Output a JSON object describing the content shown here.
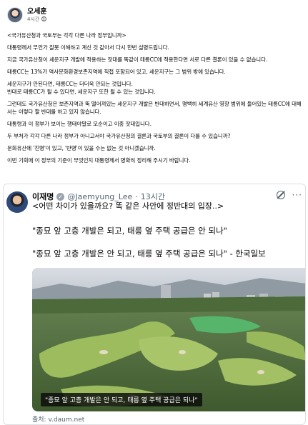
{
  "post": {
    "author": "오세훈",
    "time": "4시간",
    "paragraphs": [
      "<국가유산청과 국토부는 각각 다른 나라 정부입니까>",
      "대통령께서 무언가 잘못 이해하고 계신 것 같아서 다시 한번 설명드립니다.",
      "지금 국가유산청이 세운지구 개발에 적용하는 잣대를 똑같이 태릉CC에 적용한다면 서로 다른 결론이 있을 수 없습니다.",
      "태릉CC는 13%가 역사문화환경보존지역에 직접 포함되어 있고, 세운지구는 그 범위 밖에 있습니다.",
      "세운지구가 안된다면, 태릉CC는 더더욱 안되는 것입니다.",
      "반대로 태릉CC가 될 수 있다면, 세운지구 또한 될 수 있는 것입니다.",
      "그런데도 국가유산청은 보존지역과 뚝 떨어져있는 세운지구 개발은 반대하면서, 명백히 세계유산 영향 범위에 들어있는 태릉CC에 대해서는 이렇다 할 반대를 하고 있지 않습니다.",
      "대통령과 이 정부가 보이는 행태야말로 모순이고 이중 잣대입니다.",
      "두 부처가 각각 다른 나라 정부가 아니고서야 국가유산청의 결론과 국토부의 결론이 다를 수 있습니까?",
      "문화유산에 '친명'이 있고, '반명'이 있을 수는 없는 것 아니겠습니까.",
      "이번 기회에 이 정부의 기준이 무엇인지 대통령께서 명확히 정리해 주시기 바랍니다."
    ]
  },
  "tweet": {
    "name": "이재명",
    "handle": "@Jaemyung_Lee",
    "dot": "·",
    "time": "13시간",
    "line1": "<어떤 차이가 있을까요? 똑 같은 사안에 정반대의 입장..>",
    "line2": "\"종묘 앞 고층 개발은 되고, 태릉 옆 주택 공급은 안 되나\"",
    "line3": "\"종묘 앞 고층 개발은 안 되고, 태릉 옆 주택 공급은 되나\" - 한국일보",
    "caption": "\"종묘 앞 고층 개발은 안 되고, 태릉 옆 주택 공급은 되나\"",
    "source": "출처: v.daum.net",
    "more": "···"
  }
}
